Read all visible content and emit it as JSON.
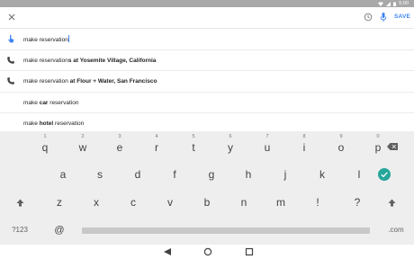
{
  "status": {
    "time": "5:00"
  },
  "searchbar": {
    "query": "make reservation",
    "save_label": "SAVE"
  },
  "suggestions": [
    {
      "icon": "touch-icon",
      "plain": "make reservation",
      "bold": "",
      "suffix": ""
    },
    {
      "icon": "phone-icon",
      "plain": "make reservation",
      "bold": "s at Yosemite Village, California",
      "suffix": ""
    },
    {
      "icon": "phone-icon",
      "plain": "make reservation ",
      "bold": "at Flour + Water, San Francisco",
      "suffix": ""
    },
    {
      "icon": "",
      "plain": "make ",
      "bold": "car",
      "suffix": " reservation"
    },
    {
      "icon": "",
      "plain": "make ",
      "bold": "hotel",
      "suffix": " reservation"
    }
  ],
  "keyboard": {
    "row1": [
      {
        "k": "q",
        "h": "1"
      },
      {
        "k": "w",
        "h": "2"
      },
      {
        "k": "e",
        "h": "3"
      },
      {
        "k": "r",
        "h": "4"
      },
      {
        "k": "t",
        "h": "5"
      },
      {
        "k": "y",
        "h": "6"
      },
      {
        "k": "u",
        "h": "7"
      },
      {
        "k": "i",
        "h": "8"
      },
      {
        "k": "o",
        "h": "9"
      },
      {
        "k": "p",
        "h": "0"
      }
    ],
    "row2": [
      "a",
      "s",
      "d",
      "f",
      "g",
      "h",
      "j",
      "k",
      "l"
    ],
    "row3": [
      "z",
      "x",
      "c",
      "v",
      "b",
      "n",
      "m",
      "!",
      "?"
    ],
    "symbols_label": "?123",
    "at_label": "@",
    "dotcom_label": ".com"
  },
  "colors": {
    "accent": "#4285f4",
    "enter": "#26a69a",
    "statusbar": "#a8a8a8",
    "keyboard": "#eeeeee"
  }
}
